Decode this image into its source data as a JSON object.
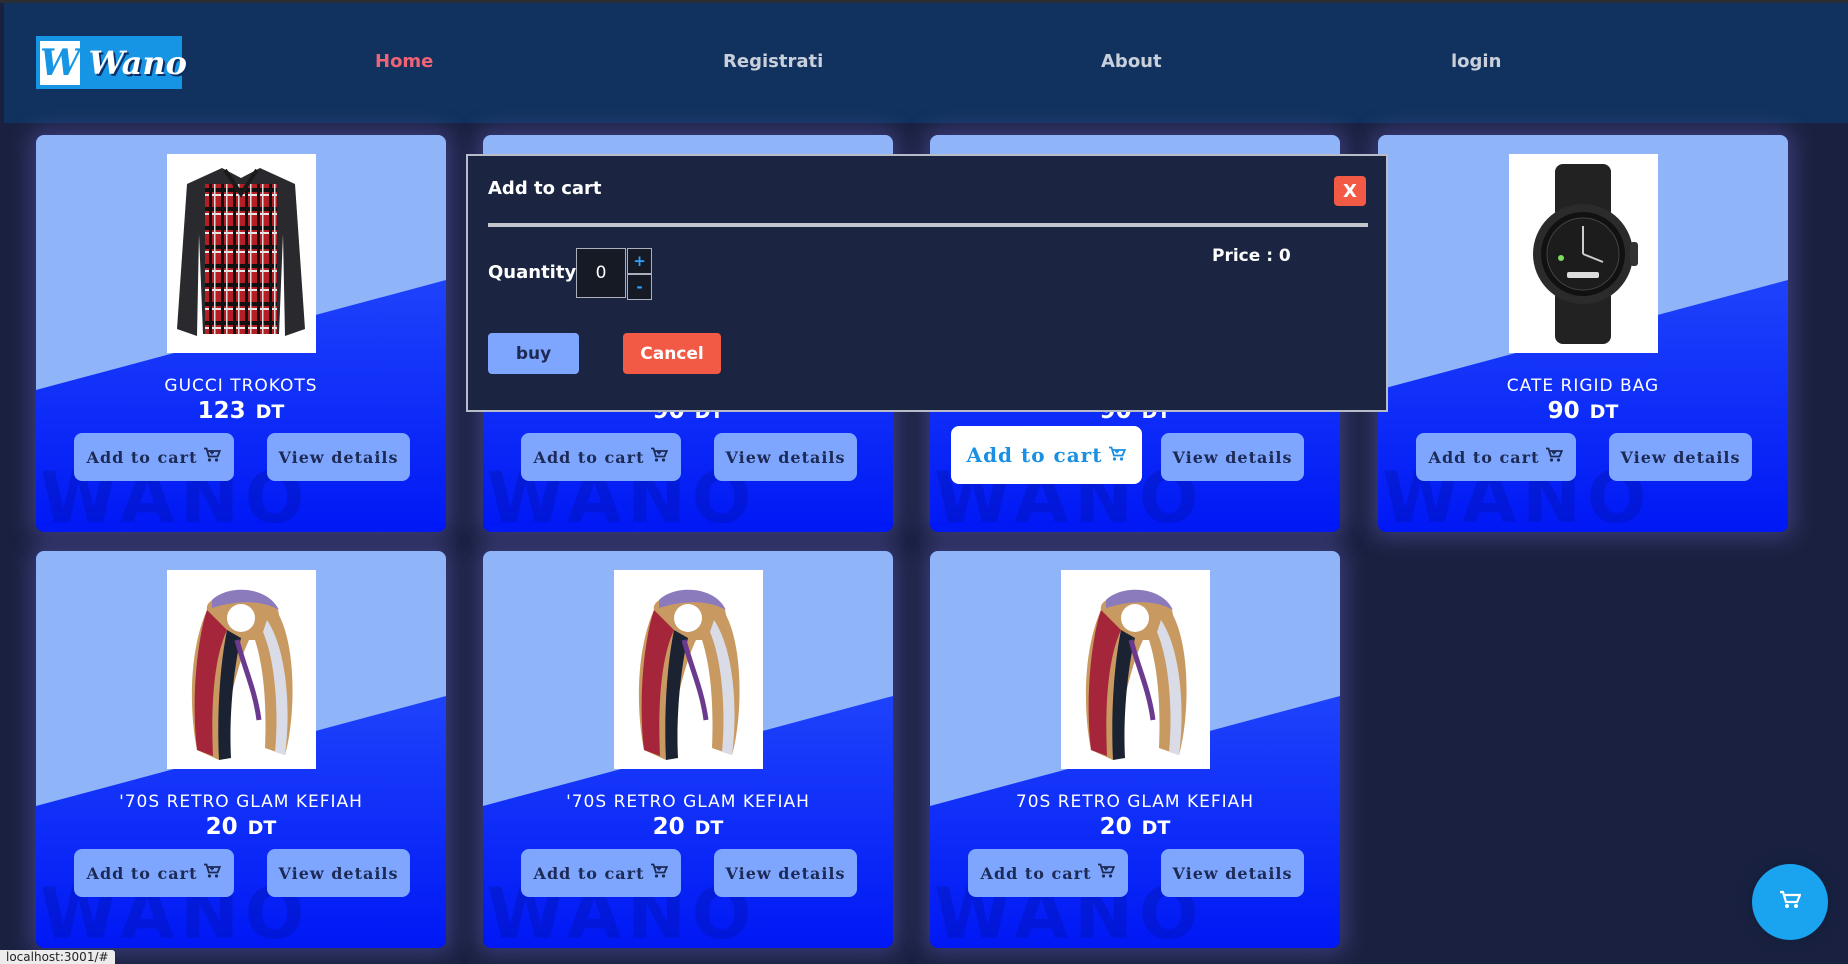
{
  "brand": {
    "logo_letter": "W",
    "name": "Wano"
  },
  "nav": [
    {
      "label": "Home",
      "active": true
    },
    {
      "label": "Registrati",
      "active": false
    },
    {
      "label": "About",
      "active": false
    },
    {
      "label": "login",
      "active": false
    }
  ],
  "products": [
    {
      "name": "GUCCI TROKOTS",
      "price": "123",
      "currency": "DT",
      "image": "plaid-shirt",
      "add_label": "Add to cart",
      "view_label": "View details",
      "watermark": "WANO"
    },
    {
      "name": "",
      "price": "90",
      "currency": "DT",
      "image": "",
      "add_label": "Add to cart",
      "view_label": "View details",
      "watermark": "WANO"
    },
    {
      "name": "",
      "price": "90",
      "currency": "DT",
      "image": "",
      "add_label": "Add to cart",
      "view_label": "View details",
      "watermark": "WANO"
    },
    {
      "name": "CATE RIGID BAG",
      "price": "90",
      "currency": "DT",
      "image": "smart-watch",
      "add_label": "Add to cart",
      "view_label": "View details",
      "watermark": "WANO"
    },
    {
      "name": "'70S RETRO GLAM KEFIAH",
      "price": "20",
      "currency": "DT",
      "image": "scarf",
      "add_label": "Add to cart",
      "view_label": "View details",
      "watermark": "WANO"
    },
    {
      "name": "'70S RETRO GLAM KEFIAH",
      "price": "20",
      "currency": "DT",
      "image": "scarf",
      "add_label": "Add to cart",
      "view_label": "View details",
      "watermark": "WANO"
    },
    {
      "name": "70S RETRO GLAM KEFIAH",
      "price": "20",
      "currency": "DT",
      "image": "scarf",
      "add_label": "Add to cart",
      "view_label": "View details",
      "watermark": "WANO"
    }
  ],
  "modal": {
    "title": "Add to cart",
    "close_label": "X",
    "quantity_label": "Quantity:",
    "quantity_value": "0",
    "increment_label": "+",
    "decrement_label": "-",
    "price_label": "Price : 0",
    "buy_label": "buy",
    "cancel_label": "Cancel"
  },
  "cart_fab": {
    "icon": "cart-icon"
  },
  "status_url": "localhost:3001/#",
  "colors": {
    "nav_bg": "#11325e",
    "page_bg": "#1a2140",
    "active_link": "#f06377",
    "card_light": "#8fb4f7",
    "card_blue": "#0018f5",
    "button_bg": "#7ea6ff",
    "danger": "#f25a45",
    "fab": "#1aa3ee"
  }
}
